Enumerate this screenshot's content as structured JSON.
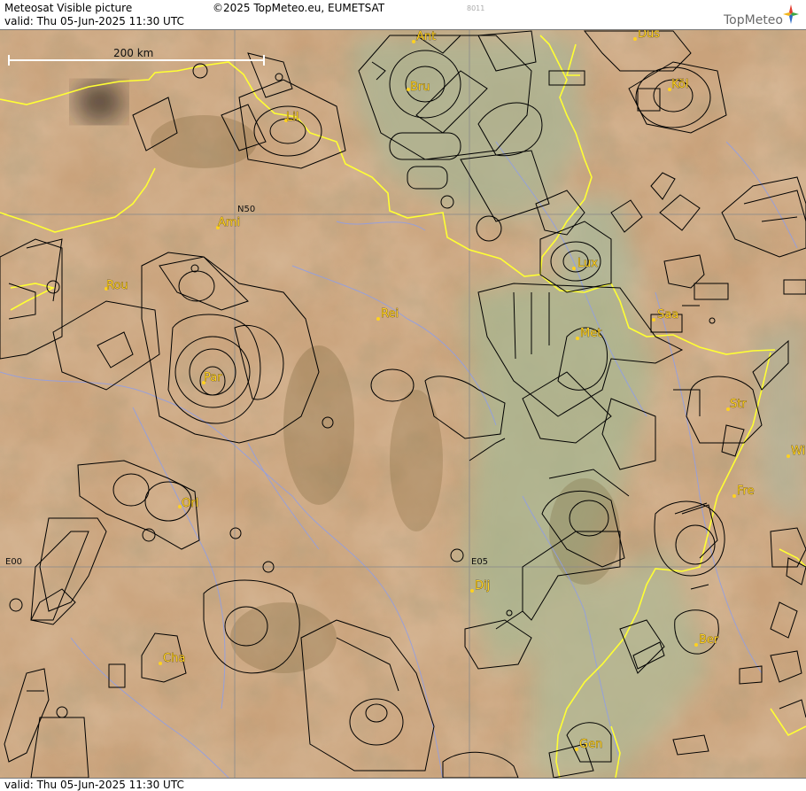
{
  "header": {
    "title": "Meteosat Visible picture",
    "valid_top": "valid:  Thu  05-Jun-2025  11:30 UTC",
    "copyright": "©2025 TopMeteo.eu, EUMETSAT",
    "code": "8011",
    "brand": "TopMeteo"
  },
  "footer": {
    "valid_bottom": "valid:  Thu  05-Jun-2025  11:30 UTC"
  },
  "scale": {
    "label": "200 km"
  },
  "grid": {
    "lat_label": "N50",
    "lon_label_w": "E00",
    "lon_label_e": "E05"
  },
  "cities": {
    "ant": "Ant",
    "dus": "Düs",
    "bru": "Bru",
    "kol": "Köl",
    "lil": "Lil",
    "ami": "Ami",
    "lux": "Lux",
    "rou": "Rou",
    "rei": "Rei",
    "saa": "Saa",
    "met": "Met",
    "par": "Par",
    "str": "Str",
    "wi": "Wi",
    "fre": "Fre",
    "orl": "Orl",
    "dij": "Dij",
    "ber": "Ber",
    "cha": "Cha",
    "gen": "Gen"
  },
  "colors": {
    "city": "#ffd21f",
    "border": "#ffff33",
    "airspace": "#000000",
    "river": "#8f9ee8",
    "grid": "#888888"
  }
}
